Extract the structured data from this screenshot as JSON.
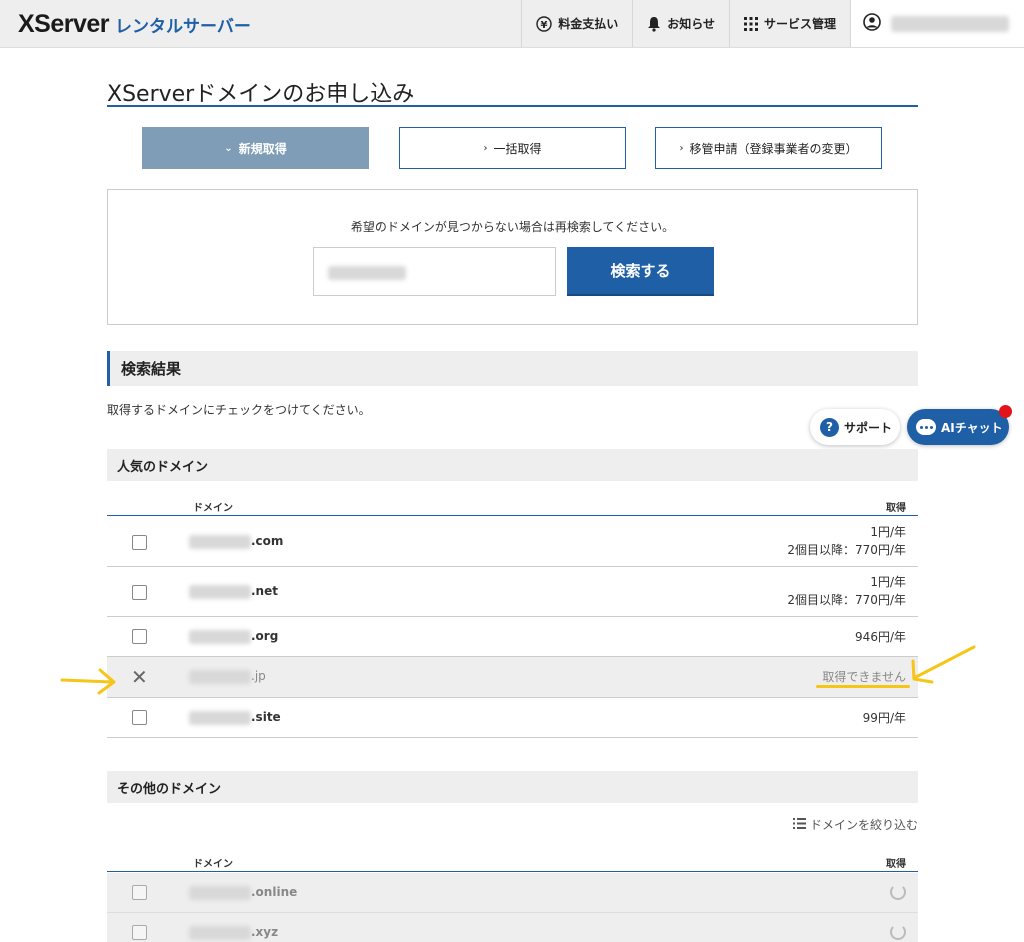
{
  "header": {
    "logo_main": "XServer",
    "logo_sub": "レンタルサーバー",
    "nav": [
      {
        "label": "料金支払い",
        "icon": "yen-icon"
      },
      {
        "label": "お知らせ",
        "icon": "bell-icon"
      },
      {
        "label": "サービス管理",
        "icon": "grid-icon"
      }
    ]
  },
  "page": {
    "title": "XServerドメインのお申し込み",
    "tabs": [
      {
        "label": "新規取得",
        "active": true
      },
      {
        "label": "一括取得",
        "active": false
      },
      {
        "label": "移管申請（登録事業者の変更）",
        "active": false
      }
    ]
  },
  "search": {
    "message": "希望のドメインが見つからない場合は再検索してください。",
    "button_label": "検索する"
  },
  "results": {
    "heading": "検索結果",
    "instruction": "取得するドメインにチェックをつけてください。",
    "popular_heading": "人気のドメイン",
    "col_domain": "ドメイン",
    "col_get": "取得",
    "popular": [
      {
        "tld": ".com",
        "price": "1円/年",
        "price2": "2個目以降：770円/年",
        "available": true
      },
      {
        "tld": ".net",
        "price": "1円/年",
        "price2": "2個目以降：770円/年",
        "available": true
      },
      {
        "tld": ".org",
        "price": "946円/年",
        "price2": "",
        "available": true
      },
      {
        "tld": ".jp",
        "price": "取得できません",
        "price2": "",
        "available": false
      },
      {
        "tld": ".site",
        "price": "99円/年",
        "price2": "",
        "available": true
      }
    ],
    "other_heading": "その他のドメイン",
    "filter_label": "ドメインを絞り込む",
    "other": [
      {
        "tld": ".online"
      },
      {
        "tld": ".xyz"
      }
    ]
  },
  "floating": {
    "support_label": "サポート",
    "chat_label": "AIチャット"
  },
  "colors": {
    "brand_blue": "#1f5fa6",
    "tab_active": "#7f9db7",
    "annotation_yellow": "#f5c518",
    "notify_red": "#e3121b"
  }
}
